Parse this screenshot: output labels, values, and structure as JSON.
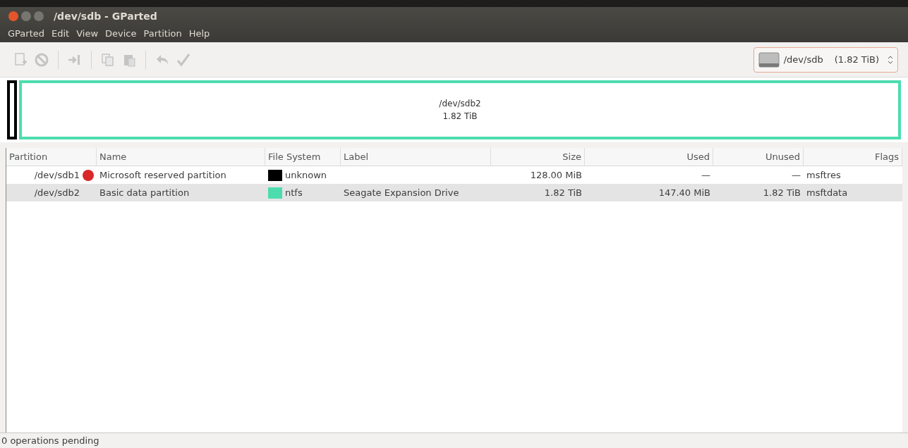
{
  "window": {
    "title": "/dev/sdb - GParted"
  },
  "menu": [
    "GParted",
    "Edit",
    "View",
    "Device",
    "Partition",
    "Help"
  ],
  "toolbar": [
    {
      "kind": "new",
      "disabled": true
    },
    {
      "kind": "delete",
      "disabled": true
    },
    {
      "kind": "separator"
    },
    {
      "kind": "resize",
      "disabled": true
    },
    {
      "kind": "separator"
    },
    {
      "kind": "copy",
      "disabled": true
    },
    {
      "kind": "paste",
      "disabled": true
    },
    {
      "kind": "separator"
    },
    {
      "kind": "undo",
      "disabled": true
    },
    {
      "kind": "apply",
      "disabled": true
    }
  ],
  "device": {
    "name": "/dev/sdb",
    "size": "(1.82 TiB)"
  },
  "partition_map": [
    {
      "color": "#000000"
    },
    {
      "color": "#4ddcae",
      "partition": "/dev/sdb2",
      "size": "1.82 TiB"
    }
  ],
  "table": {
    "columns": [
      "Partition",
      "Name",
      "File System",
      "Label",
      "Size",
      "Used",
      "Unused",
      "Flags"
    ],
    "rows": [
      {
        "partition": "/dev/sdb1",
        "warning": true,
        "name": "Microsoft reserved partition",
        "color": "#000000",
        "file_system": "unknown",
        "size": "128.00 MiB",
        "used": "—",
        "unused": "—",
        "flags": "msftres",
        "selected": false
      },
      {
        "partition": "/dev/sdb2",
        "warning": false,
        "name": "Basic data partition",
        "color": "#4ddcae",
        "file_system": "ntfs",
        "label": "Seagate Expansion Drive",
        "size": "1.82 TiB",
        "used": "147.40 MiB",
        "unused": "1.82 TiB",
        "flags": "msftdata",
        "selected": true
      }
    ]
  },
  "status_bar": "0 operations pending"
}
